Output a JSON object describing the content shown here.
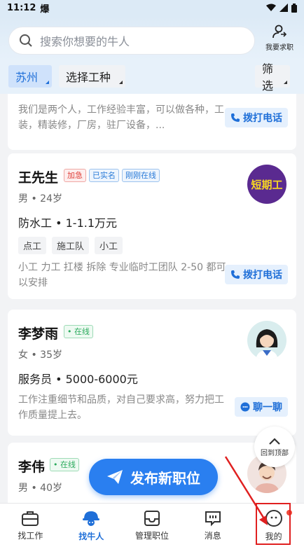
{
  "status_bar": {
    "time": "11:12",
    "notification_glyph": "爆"
  },
  "search": {
    "placeholder": "搜索你想要的牛人"
  },
  "header": {
    "job_seek_label": "我要求职"
  },
  "filters": {
    "city": "苏州",
    "job_type": "选择工种",
    "filter": "筛选"
  },
  "cards": [
    {
      "desc": "我们是两个人，工作经验丰富，可以做各种，工装，精装修，厂房，驻厂设备，..."
    },
    {
      "name": "王先生",
      "badges": [
        "加急",
        "已实名",
        "刚刚在线"
      ],
      "meta": "男 • 24岁",
      "job": "防水工 • 1-1.1万元",
      "tags": [
        "点工",
        "施工队",
        "小工"
      ],
      "desc": "小工 力工 扛楼 拆除 专业临时工团队 2-50 都可以安排",
      "avatar_text": "短期工"
    },
    {
      "name": "李梦雨",
      "badges": [
        "在线"
      ],
      "meta": "女 • 35岁",
      "job": "服务员 • 5000-6000元",
      "desc": "工作注重细节和品质，对自己要求高，努力把工作质量提上去。"
    },
    {
      "name": "李伟",
      "badges": [
        "在线"
      ],
      "meta": "男 • 40岁"
    }
  ],
  "actions": {
    "call": "拨打电话",
    "chat": "聊一聊"
  },
  "back_to_top": "回到顶部",
  "publish_button": "发布新职位",
  "tabs": [
    {
      "label": "找工作",
      "icon": "briefcase-icon"
    },
    {
      "label": "找牛人",
      "icon": "worker-helmet-icon",
      "active": true
    },
    {
      "label": "管理职位",
      "icon": "inbox-icon"
    },
    {
      "label": "消息",
      "icon": "chat-bubble-icon"
    },
    {
      "label": "我的",
      "icon": "profile-face-icon",
      "has_dot": true
    }
  ],
  "colors": {
    "accent": "#1f6fd8",
    "urgent": "#e0413b",
    "online": "#2aaa5c",
    "highlight": "#e02020"
  }
}
